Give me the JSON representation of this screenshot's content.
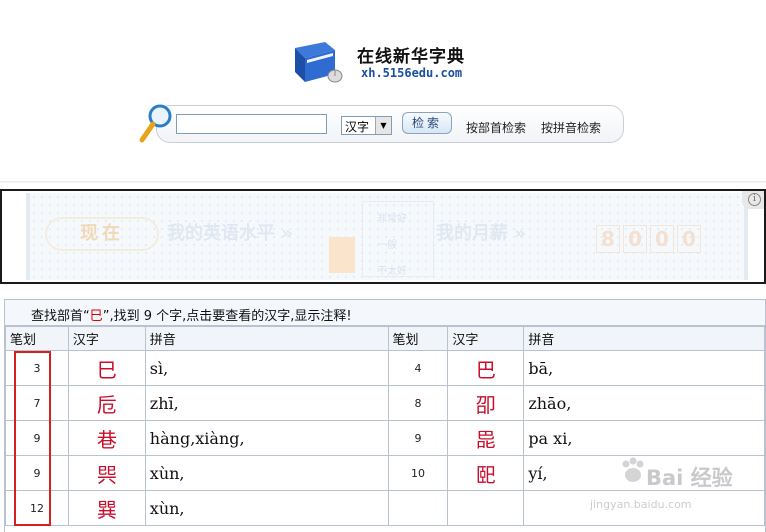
{
  "header": {
    "site_title": "在线新华字典",
    "site_url": "xh.5156edu.com"
  },
  "search": {
    "input_value": "",
    "type_selected": "汉字",
    "search_button": "检索",
    "link_radical": "按部首检索",
    "link_pinyin": "按拼音检索"
  },
  "ad": {
    "badge": "现在",
    "text1": "我的英语水平 »",
    "text2": "我的月薪 »",
    "digits": [
      "8",
      "0",
      "0",
      "0"
    ],
    "info_icon": "info-icon",
    "box_labels": [
      "非常好",
      "一般",
      "不太好"
    ]
  },
  "results": {
    "message_prefix": "查找部首“",
    "radical": "巳",
    "message_suffix": "”,找到 9 个字,点击要查看的汉字,显示注释!",
    "columns": [
      "笔划",
      "汉字",
      "拼音",
      "笔划",
      "汉字",
      "拼音"
    ],
    "rows": [
      [
        {
          "strokes": "3",
          "char": "巳",
          "pinyin": "sì,"
        },
        {
          "strokes": "4",
          "char": "巴",
          "pinyin": "bā,"
        }
      ],
      [
        {
          "strokes": "7",
          "char": "卮",
          "pinyin": "zhī,"
        },
        {
          "strokes": "8",
          "char": "卲",
          "pinyin": "zhāo,"
        }
      ],
      [
        {
          "strokes": "9",
          "char": "巷",
          "pinyin": "hàng,xiàng,"
        },
        {
          "strokes": "9",
          "char": "巼",
          "pinyin": "pa xi,"
        }
      ],
      [
        {
          "strokes": "9",
          "char": "巺",
          "pinyin": "xùn,"
        },
        {
          "strokes": "10",
          "char": "巸",
          "pinyin": "yí,"
        }
      ],
      [
        {
          "strokes": "12",
          "char": "巽",
          "pinyin": "xùn,"
        },
        {
          "strokes": "",
          "char": "",
          "pinyin": ""
        }
      ]
    ]
  },
  "watermark": {
    "brand": "Bai 经验",
    "url": "jingyan.baidu.com"
  },
  "colors": {
    "highlight_border": "#d42020",
    "character_red": "#c8102e",
    "url_blue": "#1b4fa0"
  }
}
